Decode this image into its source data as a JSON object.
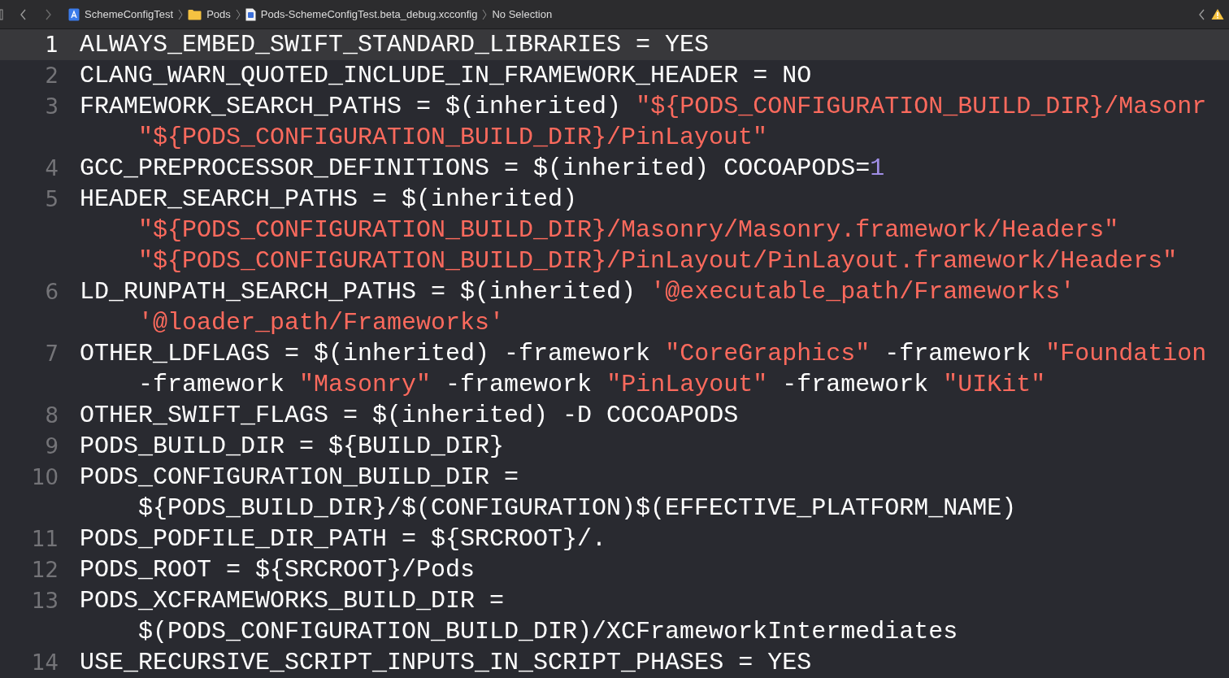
{
  "jump_bar": {
    "breadcrumbs": [
      {
        "kind": "project",
        "label": "SchemeConfigTest"
      },
      {
        "kind": "folder",
        "label": "Pods"
      },
      {
        "kind": "file",
        "label": "Pods-SchemeConfigTest.beta_debug.xcconfig"
      },
      {
        "kind": "plain",
        "label": "No Selection"
      }
    ]
  },
  "editor": {
    "lines": [
      {
        "number": "1",
        "current": true,
        "rows": [
          {
            "segments": [
              {
                "kind": "plain",
                "text": "ALWAYS_EMBED_SWIFT_STANDARD_LIBRARIES = YES"
              }
            ]
          }
        ]
      },
      {
        "number": "2",
        "current": false,
        "rows": [
          {
            "segments": [
              {
                "kind": "plain",
                "text": "CLANG_WARN_QUOTED_INCLUDE_IN_FRAMEWORK_HEADER = NO"
              }
            ]
          }
        ]
      },
      {
        "number": "3",
        "current": false,
        "rows": [
          {
            "segments": [
              {
                "kind": "plain",
                "text": "FRAMEWORK_SEARCH_PATHS = $(inherited) "
              },
              {
                "kind": "string",
                "text": "\"${PODS_CONFIGURATION_BUILD_DIR}/Masonr"
              }
            ]
          },
          {
            "segments": [
              {
                "kind": "string",
                "text": "\"${PODS_CONFIGURATION_BUILD_DIR}/PinLayout\""
              }
            ]
          }
        ]
      },
      {
        "number": "4",
        "current": false,
        "rows": [
          {
            "segments": [
              {
                "kind": "plain",
                "text": "GCC_PREPROCESSOR_DEFINITIONS = $(inherited) COCOAPODS="
              },
              {
                "kind": "number",
                "text": "1"
              }
            ]
          }
        ]
      },
      {
        "number": "5",
        "current": false,
        "rows": [
          {
            "segments": [
              {
                "kind": "plain",
                "text": "HEADER_SEARCH_PATHS = $(inherited)"
              }
            ]
          },
          {
            "segments": [
              {
                "kind": "string",
                "text": "\"${PODS_CONFIGURATION_BUILD_DIR}/Masonry/Masonry.framework/Headers\""
              }
            ]
          },
          {
            "segments": [
              {
                "kind": "string",
                "text": "\"${PODS_CONFIGURATION_BUILD_DIR}/PinLayout/PinLayout.framework/Headers\""
              }
            ]
          }
        ]
      },
      {
        "number": "6",
        "current": false,
        "rows": [
          {
            "segments": [
              {
                "kind": "plain",
                "text": "LD_RUNPATH_SEARCH_PATHS = $(inherited) "
              },
              {
                "kind": "string",
                "text": "'@executable_path/Frameworks'"
              }
            ]
          },
          {
            "segments": [
              {
                "kind": "string",
                "text": "'@loader_path/Frameworks'"
              }
            ]
          }
        ]
      },
      {
        "number": "7",
        "current": false,
        "rows": [
          {
            "segments": [
              {
                "kind": "plain",
                "text": "OTHER_LDFLAGS = $(inherited) -framework "
              },
              {
                "kind": "string",
                "text": "\"CoreGraphics\""
              },
              {
                "kind": "plain",
                "text": " -framework "
              },
              {
                "kind": "string",
                "text": "\"Foundation"
              }
            ]
          },
          {
            "segments": [
              {
                "kind": "plain",
                "text": "-framework "
              },
              {
                "kind": "string",
                "text": "\"Masonry\""
              },
              {
                "kind": "plain",
                "text": " -framework "
              },
              {
                "kind": "string",
                "text": "\"PinLayout\""
              },
              {
                "kind": "plain",
                "text": " -framework "
              },
              {
                "kind": "string",
                "text": "\"UIKit\""
              }
            ]
          }
        ]
      },
      {
        "number": "8",
        "current": false,
        "rows": [
          {
            "segments": [
              {
                "kind": "plain",
                "text": "OTHER_SWIFT_FLAGS = $(inherited) -D COCOAPODS"
              }
            ]
          }
        ]
      },
      {
        "number": "9",
        "current": false,
        "rows": [
          {
            "segments": [
              {
                "kind": "plain",
                "text": "PODS_BUILD_DIR = ${BUILD_DIR}"
              }
            ]
          }
        ]
      },
      {
        "number": "10",
        "current": false,
        "rows": [
          {
            "segments": [
              {
                "kind": "plain",
                "text": "PODS_CONFIGURATION_BUILD_DIR ="
              }
            ]
          },
          {
            "segments": [
              {
                "kind": "plain",
                "text": "${PODS_BUILD_DIR}/$(CONFIGURATION)$(EFFECTIVE_PLATFORM_NAME)"
              }
            ]
          }
        ]
      },
      {
        "number": "11",
        "current": false,
        "rows": [
          {
            "segments": [
              {
                "kind": "plain",
                "text": "PODS_PODFILE_DIR_PATH = ${SRCROOT}/."
              }
            ]
          }
        ]
      },
      {
        "number": "12",
        "current": false,
        "rows": [
          {
            "segments": [
              {
                "kind": "plain",
                "text": "PODS_ROOT = ${SRCROOT}/Pods"
              }
            ]
          }
        ]
      },
      {
        "number": "13",
        "current": false,
        "rows": [
          {
            "segments": [
              {
                "kind": "plain",
                "text": "PODS_XCFRAMEWORKS_BUILD_DIR ="
              }
            ]
          },
          {
            "segments": [
              {
                "kind": "plain",
                "text": "$(PODS_CONFIGURATION_BUILD_DIR)/XCFrameworkIntermediates"
              }
            ]
          }
        ]
      },
      {
        "number": "14",
        "current": false,
        "rows": [
          {
            "segments": [
              {
                "kind": "plain",
                "text": "USE_RECURSIVE_SCRIPT_INPUTS_IN_SCRIPT_PHASES = YES"
              }
            ]
          }
        ]
      }
    ]
  }
}
